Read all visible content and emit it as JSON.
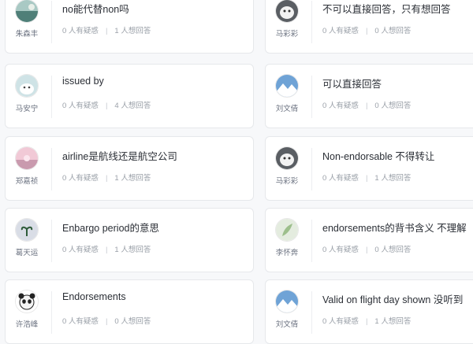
{
  "cards": [
    {
      "author": "朱森丰",
      "avatar": "avatar-landscape-teal",
      "title": "no能代替non吗",
      "doubt": "0 人有疑惑",
      "want": "1 人想回答"
    },
    {
      "author": "马彩彩",
      "avatar": "avatar-cat-white",
      "title": "不可以直接回答，只有想回答",
      "doubt": "0 人有疑惑",
      "want": "0 人想回答"
    },
    {
      "author": "马安宁",
      "avatar": "avatar-dog-white",
      "title": "issued by",
      "doubt": "0 人有疑惑",
      "want": "4 人想回答"
    },
    {
      "author": "刘文倩",
      "avatar": "avatar-mountain-blue",
      "title": "可以直接回答",
      "doubt": "0 人有疑惑",
      "want": "0 人想回答"
    },
    {
      "author": "郑嘉祯",
      "avatar": "avatar-sunset-pink",
      "title": "airline是航线还是航空公司",
      "doubt": "0 人有疑惑",
      "want": "1 人想回答"
    },
    {
      "author": "马彩彩",
      "avatar": "avatar-cat-white",
      "title": "Non-endorsable 不得转让",
      "doubt": "0 人有疑惑",
      "want": "1 人想回答"
    },
    {
      "author": "葛天运",
      "avatar": "avatar-plant-dark",
      "title": "Enbargo period的意思",
      "doubt": "0 人有疑惑",
      "want": "1 人想回答"
    },
    {
      "author": "李怀奔",
      "avatar": "avatar-leaf-light",
      "title": "endorsements的背书含义 不理解",
      "doubt": "0 人有疑惑",
      "want": "0 人想回答"
    },
    {
      "author": "许浩峰",
      "avatar": "avatar-panda-cartoon",
      "title": "Endorsements",
      "doubt": "0 人有疑惑",
      "want": "0 人想回答"
    },
    {
      "author": "刘文倩",
      "avatar": "avatar-mountain-blue",
      "title": "Valid on flight day shown 没听到",
      "doubt": "0 人有疑惑",
      "want": "1 人想回答"
    }
  ],
  "colors": {
    "background": "#f7f8fa",
    "card": "#ffffff",
    "title_text": "#2b2f36",
    "meta_text": "#9aa0a8"
  }
}
